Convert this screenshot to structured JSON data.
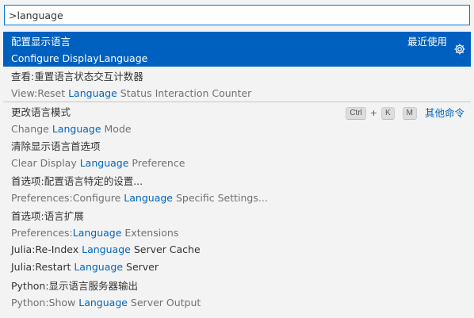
{
  "search": {
    "value": ">language"
  },
  "items": [
    {
      "label": "配置显示语言",
      "detail_pre": "Configure Display",
      "detail_hl": "Language",
      "detail_post": "",
      "right": "最近使用"
    },
    {
      "label": "查看:重置语言状态交互计数器",
      "detail_pre": "View:Reset ",
      "detail_hl": "Language",
      "detail_post": " Status Interaction Counter"
    },
    {
      "label": "更改语言模式",
      "detail_pre": "Change ",
      "detail_hl": "Language",
      "detail_post": " Mode",
      "keys": [
        "Ctrl",
        "K",
        "M"
      ],
      "plus": "+",
      "other": "其他命令"
    },
    {
      "label": "清除显示语言首选项",
      "detail_pre": "Clear Display ",
      "detail_hl": "Language",
      "detail_post": " Preference"
    },
    {
      "label": "首选项:配置语言特定的设置...",
      "detail_pre": "Preferences:Configure ",
      "detail_hl": "Language",
      "detail_post": " Specific Settings..."
    },
    {
      "label": "首选项:语言扩展",
      "detail_pre": "Preferences:",
      "detail_hl": "Language",
      "detail_post": " Extensions"
    },
    {
      "label_pre": "Julia:Re-Index ",
      "label_hl": "Language",
      "label_post": " Server Cache"
    },
    {
      "label_pre": "Julia:Restart ",
      "label_hl": "Language",
      "label_post": " Server"
    },
    {
      "label": "Python:显示语言服务器输出",
      "detail_pre": "Python:Show ",
      "detail_hl": "Language",
      "detail_post": " Server Output"
    }
  ],
  "icons": {
    "settings": "gear-icon"
  },
  "colors": {
    "selection": "#0060c0",
    "highlight": "#0066bf",
    "focus_border": "#0078d4"
  }
}
